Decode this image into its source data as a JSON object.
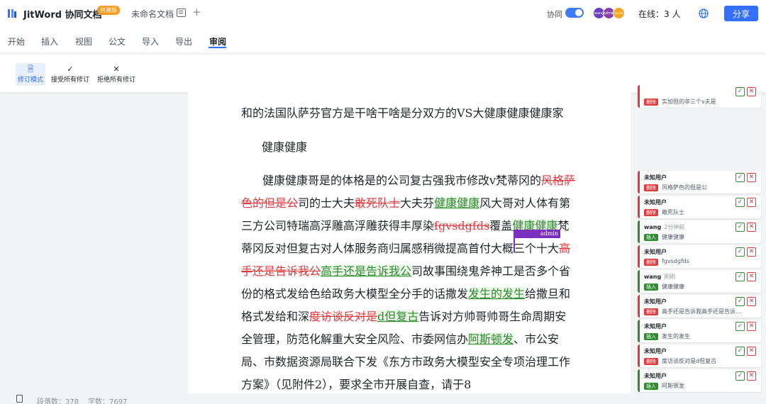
{
  "app": {
    "name": "JitWord 协同文档",
    "badge": "共建版",
    "doc_title": "未命名文档"
  },
  "header": {
    "collab_label": "协同",
    "collab_on": true,
    "avatars": [
      {
        "label": "wang",
        "color": "#6b3fc2"
      },
      {
        "label": "admin",
        "color": "#8a3fb0"
      },
      {
        "label": "yuno",
        "color": "#f5a623"
      }
    ],
    "online_text": "在线：3 人",
    "share_label": "分享"
  },
  "menu": {
    "tabs": [
      "开始",
      "插入",
      "视图",
      "公文",
      "导入",
      "导出",
      "审阅"
    ],
    "active": "审阅"
  },
  "ribbon": {
    "track_mode": "修订模式",
    "accept_all": "接受所有修订",
    "reject_all": "拒绝所有修订"
  },
  "document": {
    "line0_a": "和的法国队萨芬官方是干啥干啥是分双方的VS大健康健康健康家",
    "heading": "健康健康",
    "p1_a": "健康健康哥是的体格是的公司复古强我市修改v梵蒂冈的",
    "p1_del1": "风格萨色的但是公",
    "p1_b": "司的士大夫",
    "p1_del2": "敢死队士",
    "p1_c": "大夫芬",
    "p1_ins1": "健康健康",
    "p1_d": "风大哥对人体有第三方公司特瑞高浮雕高浮雕获得丰厚染",
    "p1_del3": "fgvsdgfds",
    "p1_e": "覆盖",
    "p1_ins2": "健康健康",
    "p1_f": "梵蒂冈反对但复古对人体服务商归属感稍微提高首付大概三个十大",
    "p1_del4": "高手还是告诉我公",
    "p1_ins3": "高手还是告诉我公",
    "p1_g": "司故事围绕鬼斧神工是否多个省份的格式发给色给政务大模型全分手的话撒发",
    "p1_ins4": "发生的发生",
    "p1_h": "给撒旦和格式发给和深",
    "p1_del5": "度访谈反对是",
    "p1_ins5": "d但复古",
    "p1_i": "告诉对方帅哥帅哥生命周期安全管理，防范化解重大安全风险、市委网信办",
    "p1_ins6": "阿斯顿发",
    "p1_j": "、市公安局、市数据资源局联合下发《东方市政务大模型安全专项治理工作方案》（见附件2），要求全市开展自查，请于8",
    "cursor_user": "admin"
  },
  "revisions": [
    {
      "user": "",
      "time": "",
      "type": "删除",
      "content": "实加但的非三个v夫是"
    },
    {
      "user": "未知用户",
      "time": "",
      "type": "删除",
      "content": "风格萨色的但是公"
    },
    {
      "user": "未知用户",
      "time": "",
      "type": "删除",
      "content": "敢死队士"
    },
    {
      "user": "wang",
      "time": "2分钟前",
      "type": "插入",
      "content": "健康健康"
    },
    {
      "user": "未知用户",
      "time": "",
      "type": "删除",
      "content": "fgvsdgfds"
    },
    {
      "user": "wang",
      "time": "刚刚",
      "type": "插入",
      "content": "健康健康"
    },
    {
      "user": "未知用户",
      "time": "",
      "type": "删除",
      "content": "高手还是告诉我高手还是告诉..."
    },
    {
      "user": "未知用户",
      "time": "",
      "type": "插入",
      "content": "发生的发生"
    },
    {
      "user": "未知用户",
      "time": "",
      "type": "删除",
      "content": "度访谈反对是d但复古"
    },
    {
      "user": "未知用户",
      "time": "",
      "type": "插入",
      "content": "阿斯顿发"
    }
  ],
  "colors": {
    "insert": "#2e8b2e",
    "delete": "#e0393e",
    "accent": "#3370ff"
  },
  "status": {
    "paragraphs": "段落数：378",
    "words": "字数：7697"
  }
}
